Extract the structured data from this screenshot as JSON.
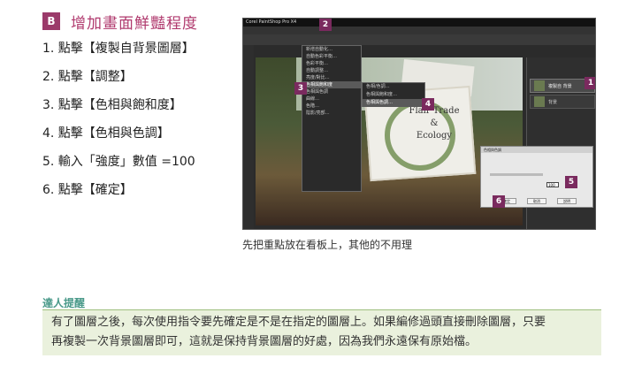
{
  "section": {
    "badge": "B",
    "title": "增加畫面鮮豔程度"
  },
  "steps": [
    "1. 點擊【複製自背景圖層】",
    "2. 點擊【調整】",
    "3. 點擊【色相與飽和度】",
    "4. 點擊【色相與色調】",
    "5. 輸入「強度」數值 =100",
    "6. 點擊【確定】"
  ],
  "screenshot": {
    "app_title": "Corel PaintShop Pro X4",
    "menu_items": [
      "新增自動化…",
      "自動色彩平衡…",
      "色彩平衡…",
      "自動調整…",
      "亮度/對比…",
      "色相與飽和度",
      "色相與色調",
      "曲線…",
      "色階…",
      "陰影/亮部…"
    ],
    "submenu_items": [
      "色相/色調…",
      "色相與飽和度…",
      "色相與色調…"
    ],
    "sign_text_1": "Flair Trade",
    "sign_text_2": "&",
    "sign_text_3": "Ecology",
    "dialog_title": "色相與色調",
    "dialog_value": "100",
    "buttons": [
      "確定",
      "取消",
      "說明"
    ],
    "layer_1": "複製自 背景",
    "layer_2": "背景",
    "callouts": [
      "1",
      "2",
      "3",
      "4",
      "5",
      "6"
    ]
  },
  "caption": "先把重點放在看板上，其他的不用理",
  "tip": {
    "title": "達人提醒",
    "line1": "有了圖層之後，每次使用指令要先確定是不是在指定的圖層上。如果編修過頭直接刪除圖層，只要",
    "line2": "再複製一次背景圖層即可，這就是保持背景圖層的好處，因為我們永遠保有原始檔。"
  },
  "colors": {
    "accent": "#9b3a6a",
    "title": "#b03a6e",
    "tip_title": "#4a9a8a",
    "tip_bg": "#eaf1dd"
  }
}
